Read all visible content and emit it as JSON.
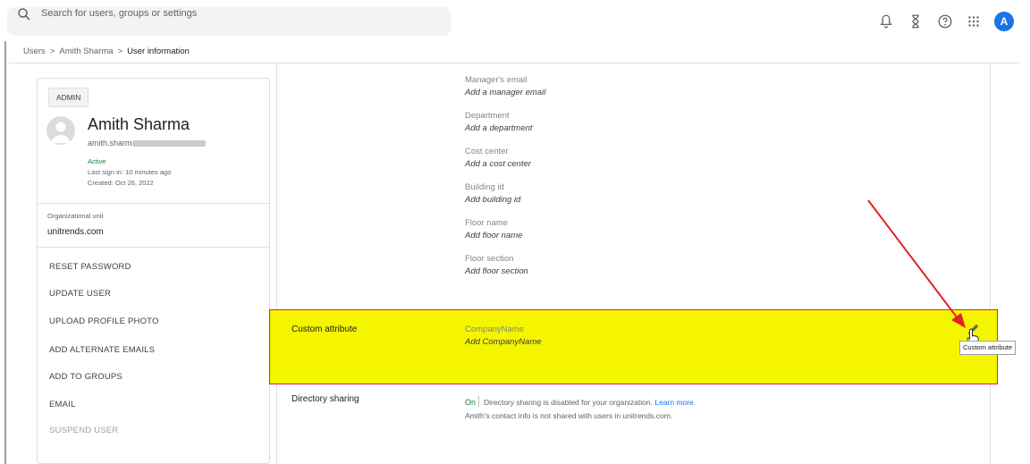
{
  "search": {
    "placeholder": "Search for users, groups or settings"
  },
  "top_icons": [
    "notifications-icon",
    "hourglass-icon",
    "help-icon",
    "apps-grid-icon"
  ],
  "account": {
    "initial": "A"
  },
  "breadcrumb": {
    "root": "Users",
    "user": "Amith Sharma",
    "current": "User information",
    "separator": ">"
  },
  "profile": {
    "badge": "ADMIN",
    "name": "Amith Sharma",
    "email_visible": "amith.sharma",
    "status": "Active",
    "last_sign_in": "Last sign in: 10 minutes ago",
    "created": "Created: Oct 26, 2022",
    "ou_label": "Organizational unit",
    "ou_value": "unitrends.com"
  },
  "actions": [
    {
      "label": "RESET PASSWORD"
    },
    {
      "label": "UPDATE USER"
    },
    {
      "label": "UPLOAD PROFILE PHOTO"
    },
    {
      "label": "ADD ALTERNATE EMAILS"
    },
    {
      "label": "ADD TO GROUPS"
    },
    {
      "label": "EMAIL"
    },
    {
      "label": "SUSPEND USER"
    }
  ],
  "fields": [
    {
      "label": "Manager's email",
      "value": "Add a manager email"
    },
    {
      "label": "Department",
      "value": "Add a department"
    },
    {
      "label": "Cost center",
      "value": "Add a cost center"
    },
    {
      "label": "Building id",
      "value": "Add building id"
    },
    {
      "label": "Floor name",
      "value": "Add floor name"
    },
    {
      "label": "Floor section",
      "value": "Add floor section"
    }
  ],
  "custom_attribute": {
    "section": "Custom attribute",
    "field_label": "CompanyName",
    "field_value": "Add CompanyName",
    "tooltip": "Custom attribute"
  },
  "directory_sharing": {
    "section": "Directory sharing",
    "status": "On",
    "message": "Directory sharing is disabled for your organization.",
    "link": "Learn more.",
    "note": "Amith's contact info is not shared with users in unitrends.com."
  },
  "colors": {
    "highlight": "#f5f500",
    "annotation": "#e0222a",
    "accent": "#1a73e8",
    "active": "#188038"
  }
}
